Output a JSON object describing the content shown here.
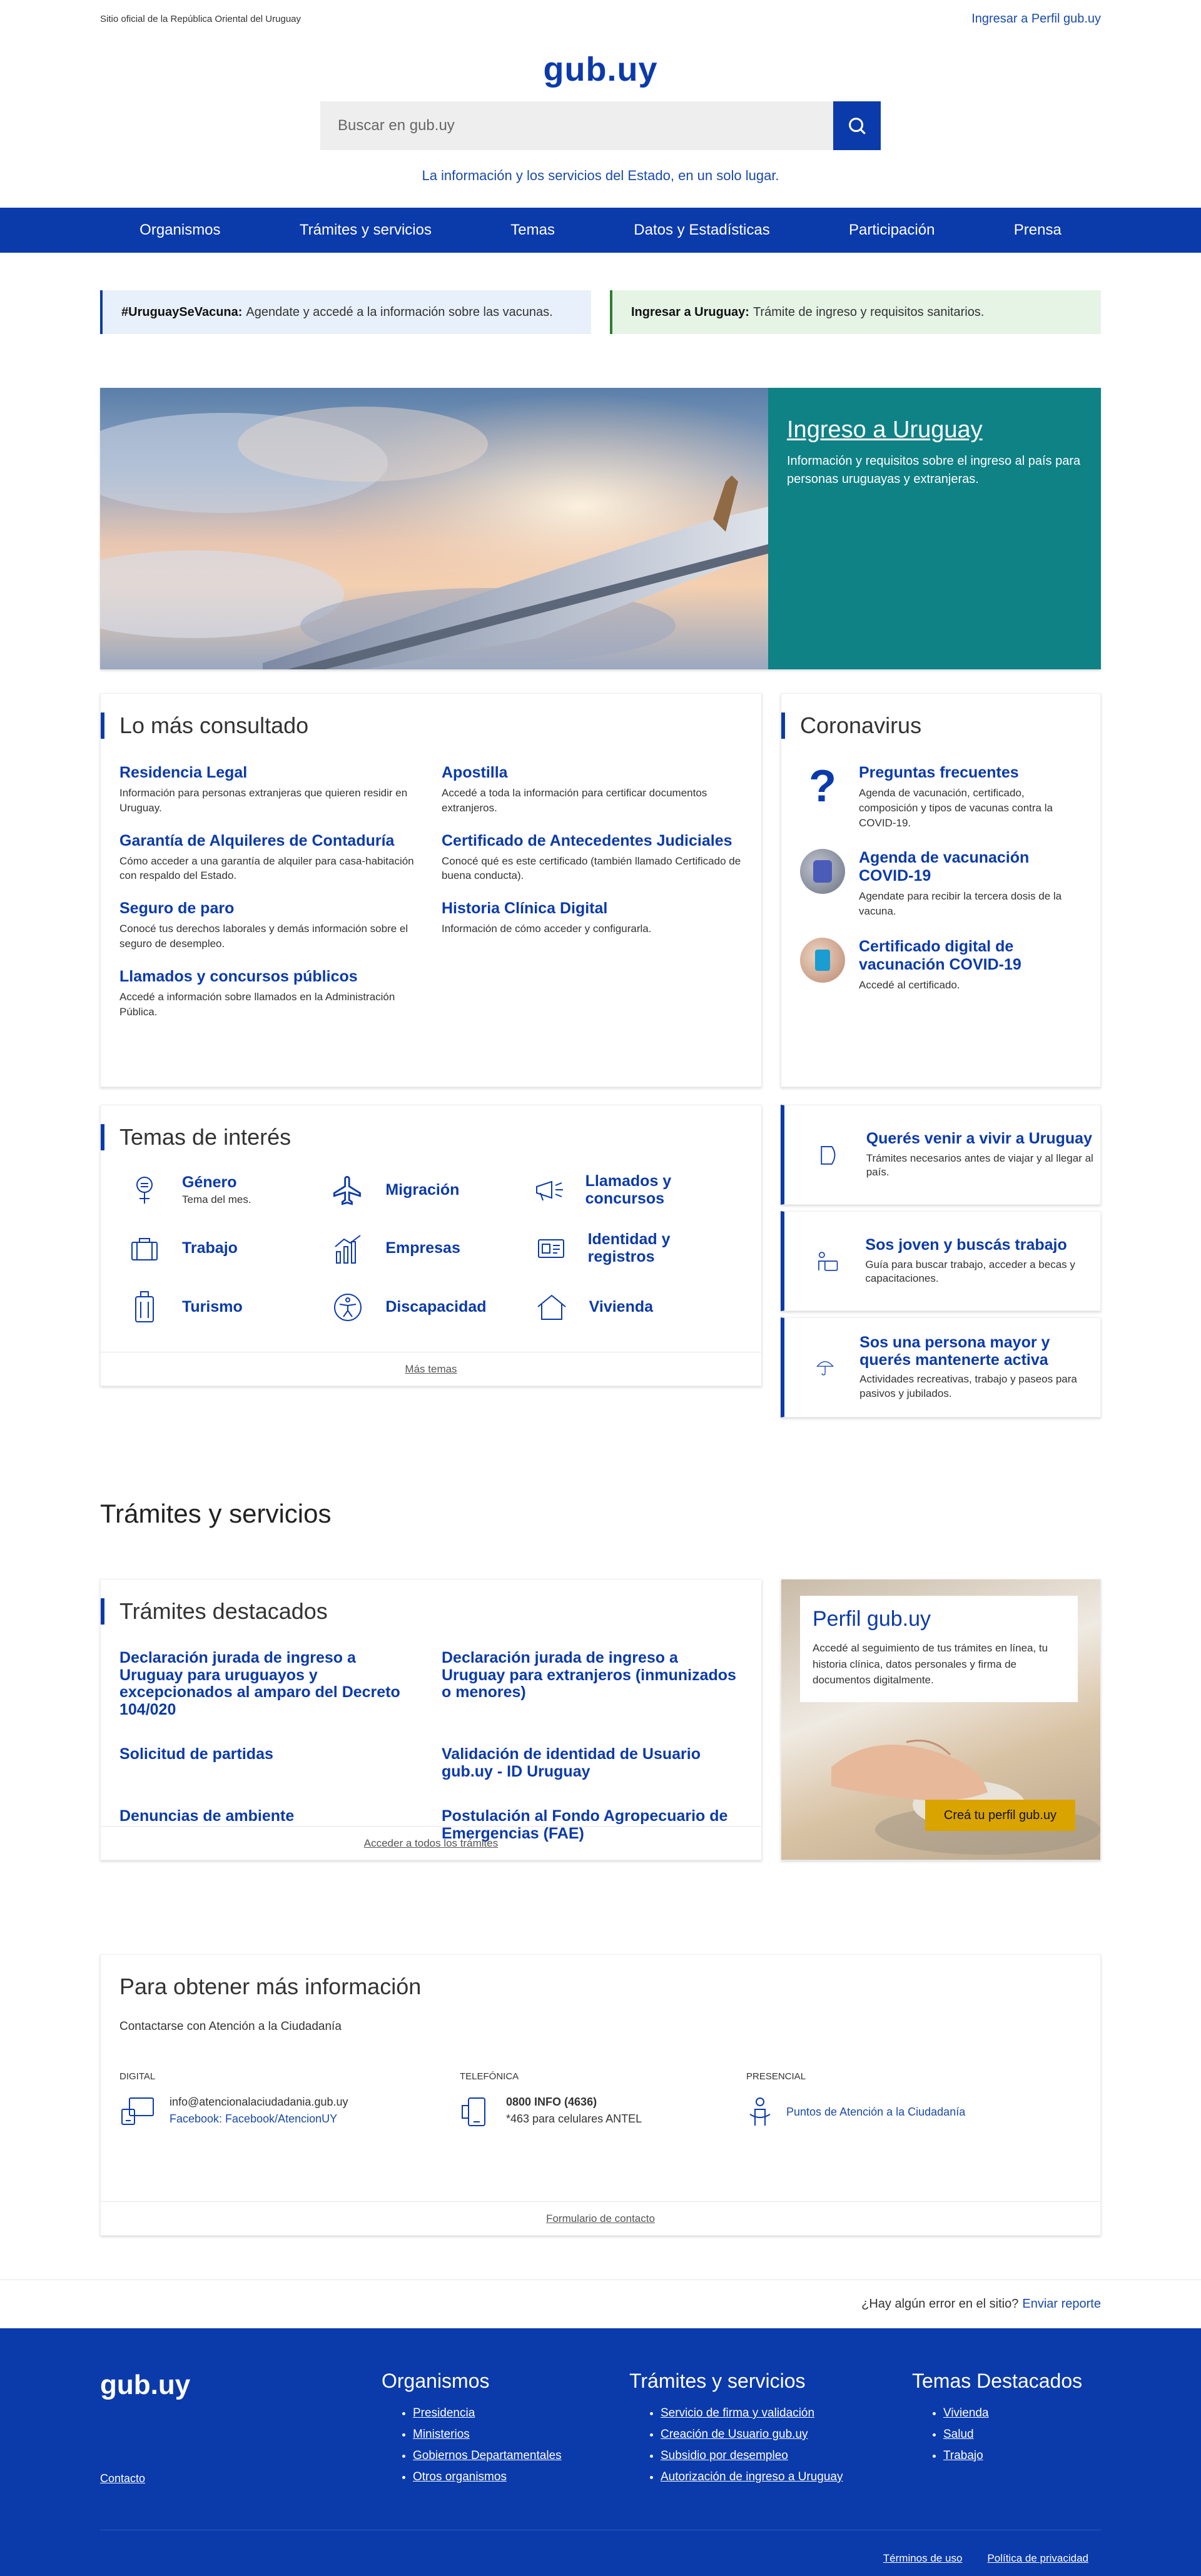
{
  "topbar": {
    "official": "Sitio oficial de la República Oriental del Uruguay",
    "login": "Ingresar a Perfil gub.uy"
  },
  "header": {
    "logo": "gub.uy",
    "search_placeholder": "Buscar en gub.uy",
    "tagline": "La información y los servicios del Estado, en un solo lugar."
  },
  "nav": [
    "Organismos",
    "Trámites y servicios",
    "Temas",
    "Datos y Estadísticas",
    "Participación",
    "Prensa"
  ],
  "alerts": [
    {
      "bold": "#UruguaySeVacuna:",
      "text": "Agendate y accedé a la información sobre las vacunas."
    },
    {
      "bold": "Ingresar a Uruguay:",
      "text": "Trámite de ingreso y requisitos sanitarios."
    }
  ],
  "hero": {
    "title": "Ingreso a Uruguay",
    "desc": "Información y requisitos sobre el ingreso al país para personas uruguayas y extranjeras."
  },
  "consult": {
    "title": "Lo más consultado",
    "items": [
      {
        "title": "Residencia Legal",
        "desc": "Información para personas extranjeras que quieren residir en Uruguay."
      },
      {
        "title": "Apostilla",
        "desc": "Accedé a toda la información para certificar documentos extranjeros."
      },
      {
        "title": "Garantía de Alquileres de Contaduría",
        "desc": "Cómo acceder a una garantía de alquiler para casa-habitación con respaldo del Estado."
      },
      {
        "title": "Certificado de Antecedentes Judiciales",
        "desc": "Conocé qué es este certificado (también llamado Certificado de buena conducta)."
      },
      {
        "title": "Seguro de paro",
        "desc": "Conocé tus derechos laborales y demás información sobre el seguro de desempleo."
      },
      {
        "title": "Historia Clínica Digital",
        "desc": "Información de cómo acceder y configurarla."
      },
      {
        "title": "Llamados y concursos públicos",
        "desc": "Accedé a información sobre llamados en la Administración Pública."
      }
    ]
  },
  "covid": {
    "title": "Coronavirus",
    "items": [
      {
        "title": "Preguntas frecuentes",
        "desc": "Agenda de vacunación, certificado, composición y tipos de vacunas contra la COVID-19."
      },
      {
        "title": "Agenda de vacunación COVID-19",
        "desc": "Agendate para recibir la tercera dosis de la vacuna."
      },
      {
        "title": "Certificado digital de vacunación COVID-19",
        "desc": "Accedé al certificado."
      }
    ]
  },
  "temas": {
    "title": "Temas de interés",
    "items": [
      {
        "label": "Género",
        "sub": "Tema del mes."
      },
      {
        "label": "Migración",
        "sub": ""
      },
      {
        "label": "Llamados y concursos",
        "sub": ""
      },
      {
        "label": "Trabajo",
        "sub": ""
      },
      {
        "label": "Empresas",
        "sub": ""
      },
      {
        "label": "Identidad y registros",
        "sub": ""
      },
      {
        "label": "Turismo",
        "sub": ""
      },
      {
        "label": "Discapacidad",
        "sub": ""
      },
      {
        "label": "Vivienda",
        "sub": ""
      }
    ],
    "more": "Más temas"
  },
  "side": [
    {
      "title": "Querés venir a vivir a Uruguay",
      "desc": "Trámites necesarios antes de viajar y al llegar al país."
    },
    {
      "title": "Sos joven y buscás trabajo",
      "desc": "Guía para buscar trabajo, acceder a becas y capacitaciones."
    },
    {
      "title": "Sos una persona mayor y querés mantenerte activa",
      "desc": "Actividades recreativas, trabajo y paseos para pasivos y jubilados."
    }
  ],
  "tramites": {
    "section_title": "Trámites y servicios",
    "card_title": "Trámites destacados",
    "items": [
      "Declaración jurada de ingreso a Uruguay para uruguayos y excepcionados al amparo del Decreto 104/020",
      "Declaración jurada de ingreso a Uruguay para extranjeros (inmunizados o menores)",
      "Solicitud de partidas",
      "Validación de identidad de Usuario gub.uy - ID Uruguay",
      "Denuncias de ambiente",
      "Postulación al Fondo Agropecuario de Emergencias (FAE)"
    ],
    "all": "Acceder a todos los trámites"
  },
  "perfil": {
    "title": "Perfil gub.uy",
    "desc": "Accedé al seguimiento de tus trámites en línea, tu historia clínica, datos personales y firma de documentos digitalmente.",
    "cta": "Creá tu perfil gub.uy"
  },
  "info": {
    "title": "Para obtener más información",
    "sub": "Contactarse con Atención a la Ciudadanía",
    "digital_cap": "Digital",
    "digital_email": "info@atencionalaciudadania.gub.uy",
    "digital_fb": "Facebook: Facebook/AtencionUY",
    "phone_cap": "Telefónica",
    "phone_main": "0800 INFO (4636)",
    "phone_sub": "*463 para celulares ANTEL",
    "presencial_cap": "Presencial",
    "presencial_link": "Puntos de Atención a la Ciudadanía",
    "form": "Formulario de contacto"
  },
  "error": {
    "text": "¿Hay algún error en el sitio?",
    "link": "Enviar reporte"
  },
  "footer": {
    "logo": "gub.uy",
    "contact": "Contacto",
    "cols": [
      {
        "title": "Organismos",
        "links": [
          "Presidencia",
          "Ministerios",
          "Gobiernos Departamentales",
          "Otros organismos"
        ]
      },
      {
        "title": "Trámites y servicios",
        "links": [
          "Servicio de firma y validación",
          "Creación de Usuario gub.uy",
          "Subsidio por desempleo",
          "Autorización de ingreso a Uruguay"
        ]
      },
      {
        "title": "Temas Destacados",
        "links": [
          "Vivienda",
          "Salud",
          "Trabajo"
        ]
      }
    ],
    "legal": [
      "Términos de uso",
      "Política de privacidad"
    ]
  },
  "colors": {
    "primary": "#0b3aaa",
    "teal": "#0f8286",
    "cta": "#d9a400"
  }
}
